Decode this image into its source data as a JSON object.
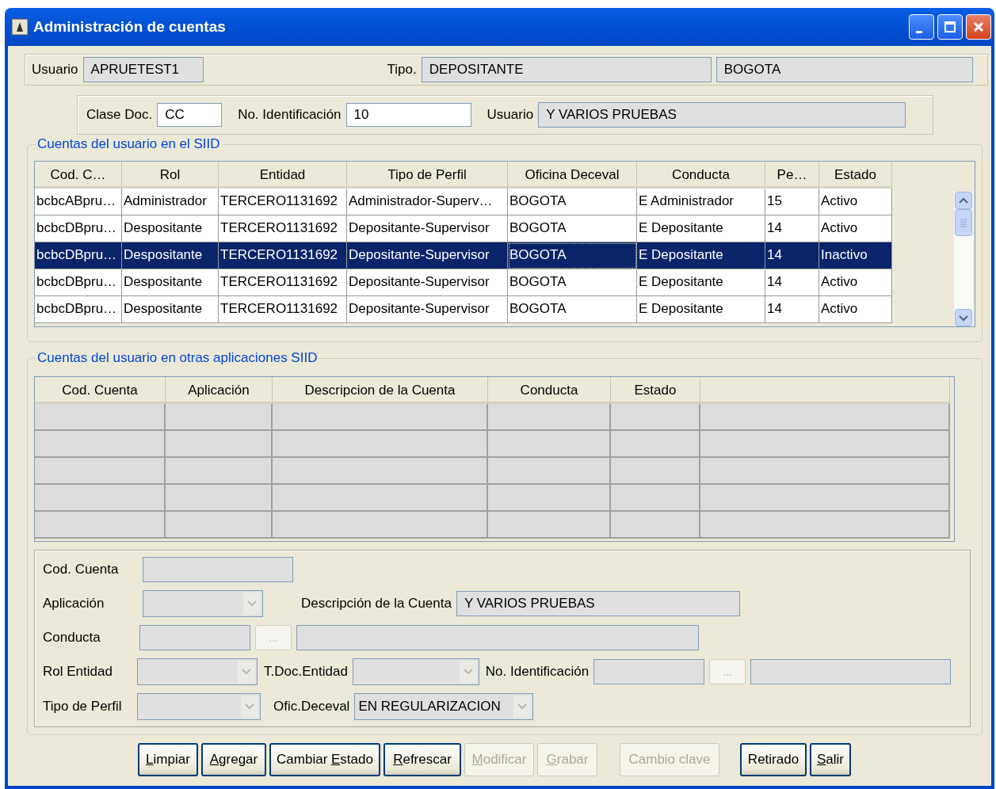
{
  "window": {
    "title": "Administración de cuentas"
  },
  "header": {
    "usuario_label": "Usuario",
    "usuario": "APRUETEST1",
    "tipo_label": "Tipo.",
    "tipo": "DEPOSITANTE",
    "ciudad": "BOGOTA"
  },
  "identification": {
    "clase_label": "Clase Doc.",
    "clase": "CC",
    "numero_label": "No. Identificación",
    "numero": "10",
    "usuario_label": "Usuario",
    "usuario": "Y VARIOS PRUEBAS"
  },
  "accounts": {
    "title": "Cuentas del usuario en el SIID",
    "columns": [
      "Cod. C…",
      "Rol",
      "Entidad",
      "Tipo de Perfil",
      "Oficina Deceval",
      "Conducta",
      "Pe…",
      "Estado"
    ],
    "rows": [
      {
        "cells": [
          "bcbcABpru…",
          "Administrador",
          "TERCERO1131692",
          "Administrador-Superv…",
          "BOGOTA",
          "E Administrador",
          "15",
          "Activo"
        ],
        "selected": false
      },
      {
        "cells": [
          "bcbcDBpru…",
          "Despositante",
          "TERCERO1131692",
          "Depositante-Supervisor",
          "BOGOTA",
          "E Depositante",
          "14",
          "Activo"
        ],
        "selected": false
      },
      {
        "cells": [
          "bcbcDBpru…",
          "Despositante",
          "TERCERO1131692",
          "Depositante-Supervisor",
          "BOGOTA",
          "E Depositante",
          "14",
          "Inactivo"
        ],
        "selected": true
      },
      {
        "cells": [
          "bcbcDBpru…",
          "Despositante",
          "TERCERO1131692",
          "Depositante-Supervisor",
          "BOGOTA",
          "E Depositante",
          "14",
          "Activo"
        ],
        "selected": false
      },
      {
        "cells": [
          "bcbcDBpru…",
          "Despositante",
          "TERCERO1131692",
          "Depositante-Supervisor",
          "BOGOTA",
          "E Depositante",
          "14",
          "Activo"
        ],
        "selected": false
      }
    ]
  },
  "other_accounts": {
    "title": "Cuentas del usuario en otras aplicaciones SIID",
    "columns": [
      "Cod. Cuenta",
      "Aplicación",
      "Descripcion de la Cuenta",
      "Conducta",
      "Estado"
    ]
  },
  "form": {
    "cod_cuenta_label": "Cod. Cuenta",
    "aplicacion_label": "Aplicación",
    "descripcion_label": "Descripción de la Cuenta",
    "descripcion": "Y VARIOS PRUEBAS",
    "conducta_label": "Conducta",
    "conducta_lookup": "...",
    "rol_entidad_label": "Rol Entidad",
    "tdoc_label": "T.Doc.Entidad",
    "no_id_label": "No. Identificación",
    "no_id_lookup": "...",
    "tipo_perfil_label": "Tipo de Perfil",
    "ofic_label": "Ofic.Deceval",
    "ofic": "EN REGULARIZACION"
  },
  "buttons": [
    {
      "key": "L",
      "post": "impiar",
      "disabled": false
    },
    {
      "key": "A",
      "post": "gregar",
      "disabled": false
    },
    {
      "pre": "Cambiar ",
      "key": "E",
      "post": "stado",
      "disabled": false
    },
    {
      "key": "R",
      "post": "efrescar",
      "disabled": false
    },
    {
      "key": "M",
      "post": "odificar",
      "disabled": true
    },
    {
      "key": "G",
      "post": "rabar",
      "disabled": true
    },
    {
      "pre": "Cambio clave",
      "disabled": true
    },
    {
      "pre": "Retirado",
      "disabled": false
    },
    {
      "key": "S",
      "post": "alir",
      "disabled": false
    }
  ]
}
